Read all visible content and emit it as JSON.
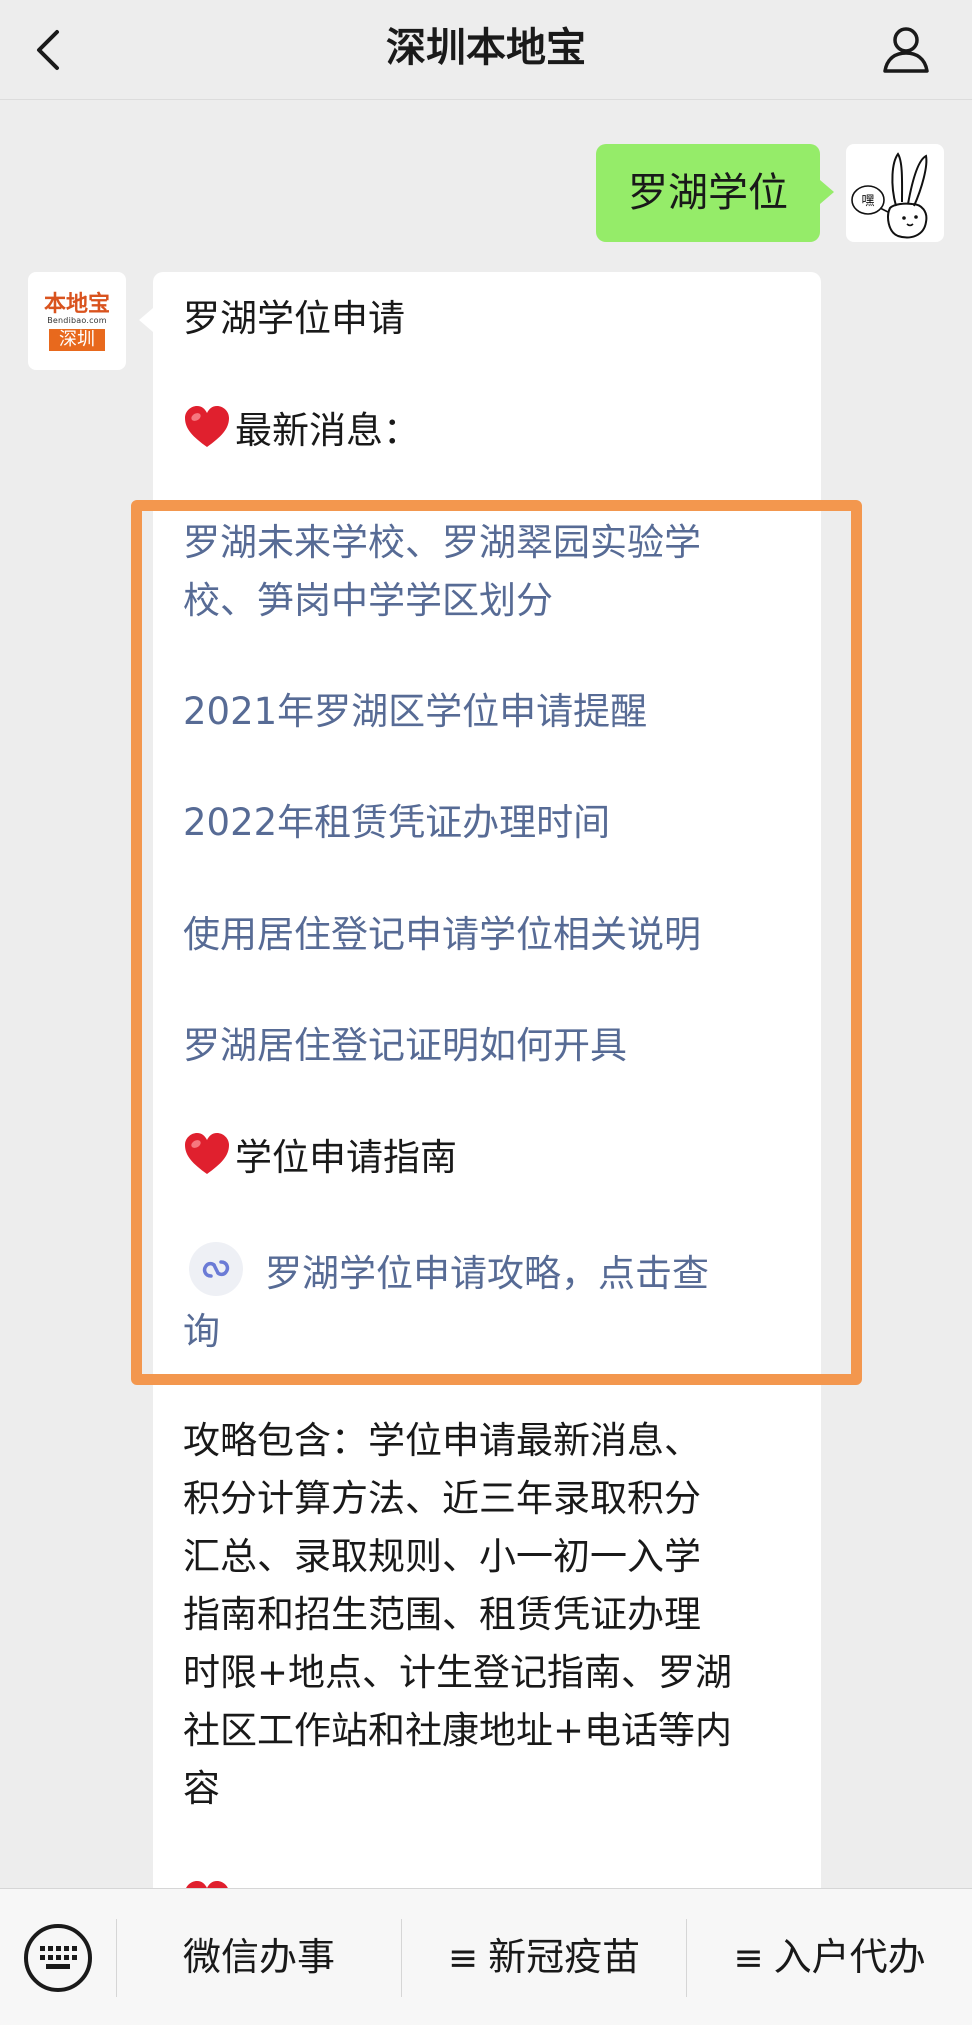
{
  "header": {
    "title": "深圳本地宝",
    "back_icon": "chevron-left-icon",
    "profile_icon": "person-icon"
  },
  "outgoing": {
    "text": "罗湖学位"
  },
  "bot": {
    "avatar": {
      "logo_text": "本地宝",
      "logo_url": "Bendibao.com",
      "logo_city": "深圳"
    }
  },
  "message": {
    "title": "罗湖学位申请",
    "section1": "最新消息：",
    "links": [
      {
        "line1": "罗湖未来学校、罗湖翠园实验学",
        "line2": "校、笋岗中学学区划分"
      },
      {
        "line1": "2021年罗湖区学位申请提醒"
      },
      {
        "line1": "2022年租赁凭证办理时间"
      },
      {
        "line1": "使用居住登记申请学位相关说明"
      },
      {
        "line1": "罗湖居住登记证明如何开具"
      }
    ],
    "section2": "学位申请指南",
    "miniprogram_link": {
      "line1": "罗湖学位申请攻略，点击查",
      "line2": "询"
    },
    "summary_lines": [
      "攻略包含：学位申请最新消息、",
      "积分计算方法、近三年录取积分",
      "汇总、录取规则、小一初一入学",
      "指南和招生范围、租赁凭证办理",
      "时限+地点、计生登记指南、罗湖",
      "社区工作站和社康地址+电话等内",
      "容"
    ]
  },
  "menu": {
    "keyboard_icon": "keyboard-icon",
    "items": [
      {
        "label": "微信办事",
        "icon": ""
      },
      {
        "label": "新冠疫苗",
        "icon": "≡"
      },
      {
        "label": "入户代办",
        "icon": "≡"
      }
    ]
  },
  "colors": {
    "background": "#ededed",
    "outgoing_bubble": "#95ec69",
    "link": "#576b95",
    "highlight": "#f3974e"
  }
}
